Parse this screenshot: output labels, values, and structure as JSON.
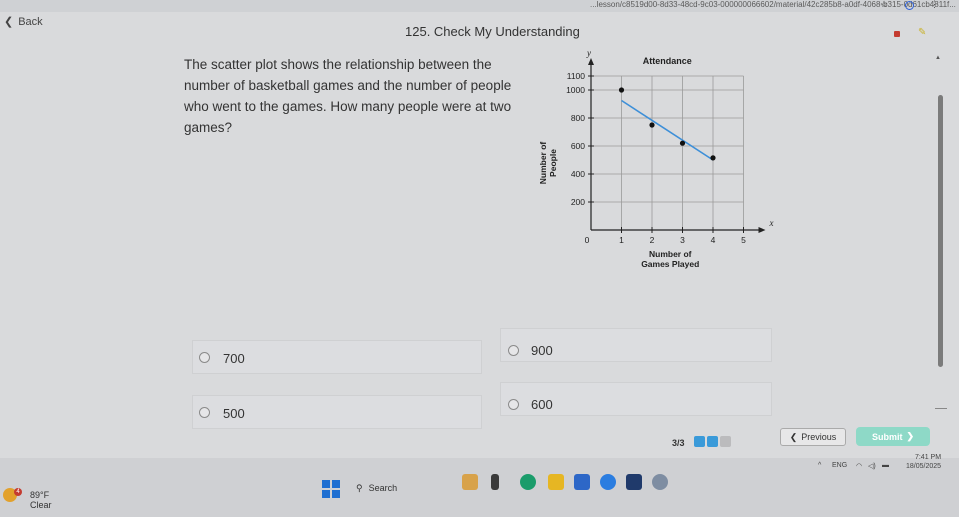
{
  "browser": {
    "url": "...lesson/c8519d00-8d33-48cd-9c03-000000066602/material/42c285b8-a0df-4068-b315-0d61cb4811f..."
  },
  "header": {
    "back_label": "Back",
    "title": "125. Check My Understanding"
  },
  "question": {
    "text": "The scatter plot shows the relationship between the number of basketball games and the number of people who went to the games. How many people were at two games?"
  },
  "chart_data": {
    "type": "scatter",
    "title": "Attendance",
    "xlabel": "Number of Games Played",
    "xlabel_lines": [
      "Number of",
      "Games Played"
    ],
    "ylabel": "Number of People",
    "ylabel_lines": [
      "Number of",
      "People"
    ],
    "x_axis_letter": "x",
    "y_axis_letter": "y",
    "xlim": [
      0,
      5
    ],
    "ylim": [
      0,
      1100
    ],
    "xticks": [
      0,
      1,
      2,
      3,
      4,
      5
    ],
    "xtick_labels": [
      "0",
      "1",
      "2",
      "3",
      "4",
      "5"
    ],
    "yticks": [
      200,
      400,
      600,
      800,
      1000,
      1100
    ],
    "ytick_labels": [
      "200",
      "400",
      "600",
      "800",
      "1000",
      "1100"
    ],
    "grid": true,
    "points": [
      {
        "x": 1,
        "y": 1000
      },
      {
        "x": 2,
        "y": 750
      },
      {
        "x": 3,
        "y": 620
      },
      {
        "x": 4,
        "y": 515
      }
    ],
    "trend_line": {
      "x": [
        1,
        4
      ],
      "y": [
        925,
        500
      ],
      "color": "#3d8fd8"
    },
    "point_color": "#111111"
  },
  "choices": [
    {
      "label": "700"
    },
    {
      "label": "900"
    },
    {
      "label": "500"
    },
    {
      "label": "600"
    }
  ],
  "footer": {
    "progress": "3/3",
    "previous_label": "Previous",
    "submit_label": "Submit"
  },
  "taskbar": {
    "weather_temp": "89°F",
    "weather_cond": "Clear",
    "weather_badge": "4",
    "search_label": "Search",
    "lang": "ENG",
    "time": "7:41 PM",
    "date": "18/05/2025"
  }
}
